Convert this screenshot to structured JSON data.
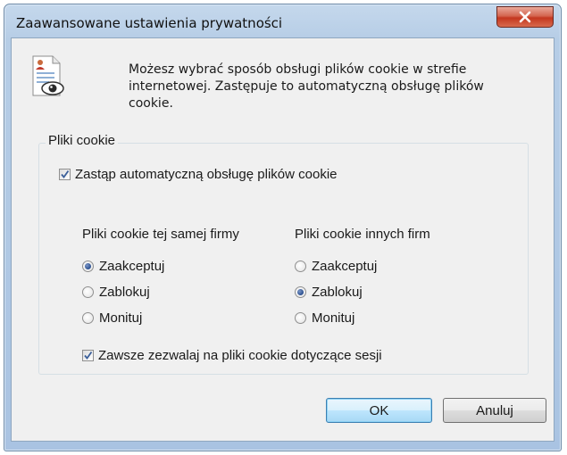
{
  "window": {
    "title": "Zaawansowane ustawienia prywatności",
    "close_icon": "close-x-icon"
  },
  "intro": {
    "icon": "privacy-document-eye-icon",
    "text": "Możesz wybrać sposób obsługi plików cookie w strefie internetowej. Zastępuje to automatyczną obsługę plików cookie."
  },
  "cookies_group": {
    "legend": "Pliki cookie",
    "override": {
      "label": "Zastąp automatyczną obsługę plików cookie",
      "checked": true
    },
    "first_party": {
      "heading": "Pliki cookie tej samej firmy",
      "options": [
        {
          "label": "Zaakceptuj",
          "selected": true
        },
        {
          "label": "Zablokuj",
          "selected": false
        },
        {
          "label": "Monituj",
          "selected": false
        }
      ]
    },
    "third_party": {
      "heading": "Pliki cookie innych firm",
      "options": [
        {
          "label": "Zaakceptuj",
          "selected": false
        },
        {
          "label": "Zablokuj",
          "selected": true
        },
        {
          "label": "Monituj",
          "selected": false
        }
      ]
    },
    "session": {
      "label": "Zawsze zezwalaj na pliki cookie dotyczące sesji",
      "checked": true
    }
  },
  "buttons": {
    "ok": "OK",
    "cancel": "Anuluj"
  }
}
